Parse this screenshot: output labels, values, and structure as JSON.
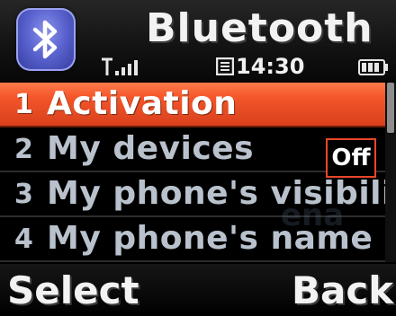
{
  "header": {
    "title": "Bluetooth",
    "icon": "bluetooth-icon",
    "icon_color": "#5a63cf"
  },
  "status_bar": {
    "signal_icon": "signal-strength-icon",
    "message_icon": "message-icon",
    "time": "14:30",
    "battery_icon": "battery-icon"
  },
  "menu": {
    "items": [
      {
        "number": "1",
        "label": "Activation",
        "selected": true
      },
      {
        "number": "2",
        "label": "My devices",
        "selected": false
      },
      {
        "number": "3",
        "label": "My phone's visibility",
        "selected": false
      },
      {
        "number": "4",
        "label": "My phone's name",
        "selected": false
      }
    ],
    "status_badge": "Off"
  },
  "watermark": "ena",
  "softkeys": {
    "left": "Select",
    "right": "Back"
  },
  "colors": {
    "highlight": "#f4552a",
    "badge_border": "#e8462a",
    "menu_text": "#b9c2cc"
  }
}
